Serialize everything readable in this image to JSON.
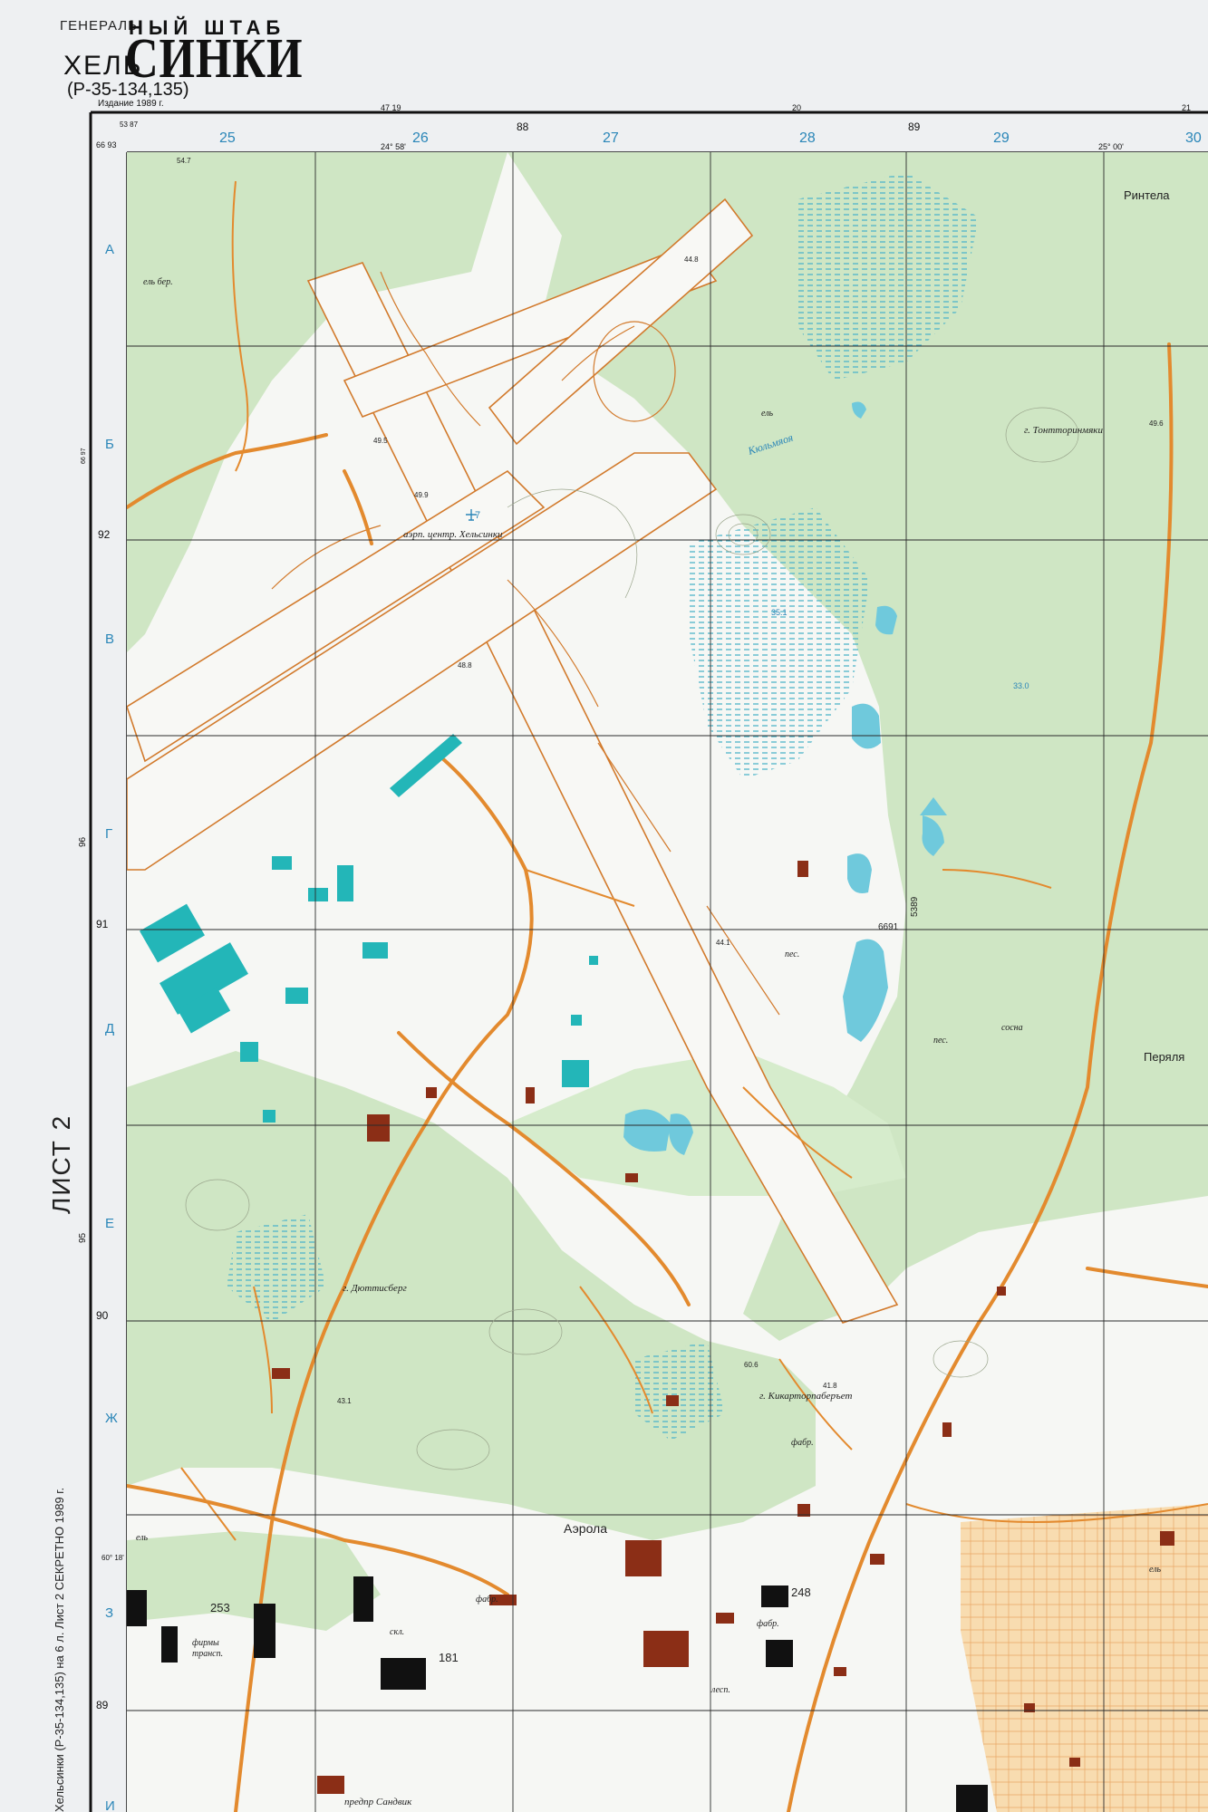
{
  "header": {
    "general": "ГЕНЕРАЛЬ",
    "shtab": "НЫЙ ШТАБ",
    "city_prefix": "ХЕЛЬ",
    "city_main": "СИНКИ",
    "sheet_code": "(Р-35-134,135)",
    "edition": "Издание 1989 г."
  },
  "side": {
    "sheet_label": "ЛИСТ 2",
    "bottom_note": "Хельсинки (Р-35-134,135) на 6 л. Лист 2 СЕКРЕТНО 1989 г."
  },
  "frame_top": {
    "corner": "53 87",
    "corner_small": "66 93",
    "ticks": [
      "47 19",
      "24° 58'",
      "88",
      "20",
      "89",
      "25° 00'",
      "21"
    ],
    "columns": [
      "25",
      "26",
      "27",
      "28",
      "29",
      "30"
    ]
  },
  "frame_left": {
    "rows": [
      "А",
      "Б",
      "В",
      "Г",
      "Д",
      "Е",
      "Ж",
      "З",
      "И"
    ],
    "grid_numbers": [
      "92",
      "96",
      "91",
      "95",
      "90",
      "89",
      "60° 18'",
      "66 97"
    ]
  },
  "places": {
    "airport": "аэрп. центр. Хельсинки",
    "kylmaoja": "Кюльмяоя",
    "tontorinmaki": "г. Тонтторинмяки",
    "rintela": "Ринтела",
    "perya": "Перяля",
    "dyuttisberg": "г. Дюттисберг",
    "kikartorpaberget": "г. Кикарторпаберъет",
    "aerola": "Аэрола",
    "sandvik": "предпр Сандвик"
  },
  "labels": {
    "el_ber": "ель бер.",
    "el1": "ель",
    "el2": "ель",
    "el3": "ель",
    "sosna": "сосна",
    "pes1": "пес.",
    "pes2": "пес.",
    "fabr1": "фабр.",
    "fabr2": "фабр.",
    "fabr3": "фабр.",
    "skl": "скл.",
    "firmy": "фирмы",
    "trans": "трансп.",
    "lesp": "лесп."
  },
  "elevations": {
    "e547": "54.7",
    "e448": "44.8",
    "e495": "49.5",
    "e499": "49.9",
    "e488": "48.8",
    "e441": "44.1",
    "e351": "35.1",
    "e330": "33.0",
    "e496": "49.6",
    "e606": "60.6",
    "e418": "41.8",
    "e431": "43.1"
  },
  "numbers": {
    "n7": "7",
    "n6691": "6691",
    "n5389": "5389",
    "n253": "253",
    "n181": "181",
    "n248": "248"
  },
  "colors": {
    "forest": "#cfe6c4",
    "open": "#f6f7f4",
    "road": "#e38a2e",
    "water": "#6fc9dc",
    "grid": "#2b2b2b",
    "building_red": "#8b2e16",
    "building_cyan": "#23b6b8",
    "urban": "#f7d7a8"
  }
}
